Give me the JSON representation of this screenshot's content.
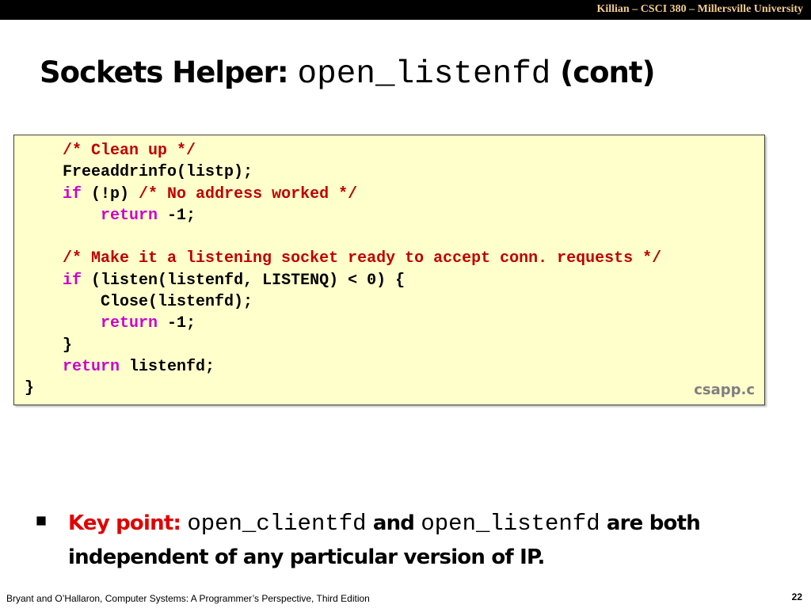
{
  "header": {
    "credit": "Killian – CSCI 380 – Millersville University"
  },
  "slide": {
    "title_text": "Sockets Helper: ",
    "title_code": "open_listenfd",
    "title_suffix": " (cont)",
    "code_lines": [
      [
        {
          "t": "    "
        },
        {
          "t": "/* Clean up */",
          "c": "cm"
        }
      ],
      [
        {
          "t": "    Freeaddrinfo(listp);"
        }
      ],
      [
        {
          "t": "    "
        },
        {
          "t": "if",
          "c": "kw"
        },
        {
          "t": " (!p) "
        },
        {
          "t": "/* No address worked */",
          "c": "cm"
        }
      ],
      [
        {
          "t": "        "
        },
        {
          "t": "return",
          "c": "kw"
        },
        {
          "t": " -1;"
        }
      ],
      [
        {
          "t": ""
        }
      ],
      [
        {
          "t": "    "
        },
        {
          "t": "/* Make it a listening socket ready to accept conn. requests */",
          "c": "cm"
        }
      ],
      [
        {
          "t": "    "
        },
        {
          "t": "if",
          "c": "kw"
        },
        {
          "t": " (listen(listenfd, LISTENQ) < 0) {"
        }
      ],
      [
        {
          "t": "        Close(listenfd);"
        }
      ],
      [
        {
          "t": "        "
        },
        {
          "t": "return",
          "c": "kw"
        },
        {
          "t": " -1;"
        }
      ],
      [
        {
          "t": "    }"
        }
      ],
      [
        {
          "t": "    "
        },
        {
          "t": "return",
          "c": "kw"
        },
        {
          "t": " listenfd;"
        }
      ],
      [
        {
          "t": "}"
        }
      ]
    ],
    "source_file": "csapp.c",
    "key_point": {
      "label": "Key point:",
      "code1": "open_clientfd",
      "and_word": "and",
      "code2": "open_listenfd",
      "rest": "are both independent of any particular version of IP."
    }
  },
  "footer": {
    "citation": "Bryant and O’Hallaron, Computer Systems: A Programmer’s Perspective, Third Edition",
    "page_number": "22"
  },
  "colors": {
    "header_bg": "#000000",
    "header_text": "#f2cc8f",
    "code_bg": "#ffffcc",
    "comment": "#c00000",
    "keyword": "#cc00cc",
    "key_point_label": "#e00000",
    "source_file": "#7f7f7f"
  }
}
